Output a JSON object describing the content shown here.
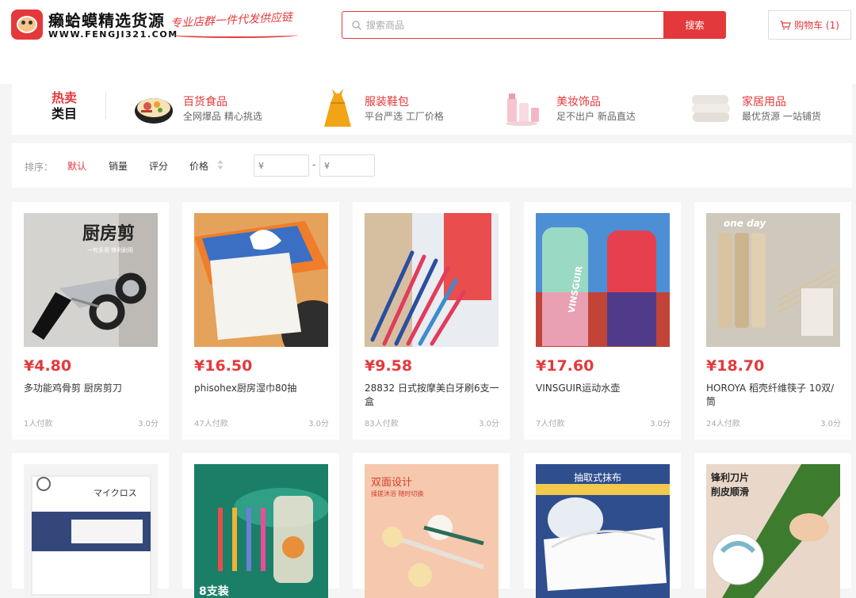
{
  "header": {
    "brand_name": "癞蛤蟆精选货源",
    "brand_domain": "WWW.FENGJI321.COM",
    "slogan": "专业店群一件代发供应链",
    "search_placeholder": "搜索商品",
    "search_button": "搜索",
    "cart_label": "购物车 (1)"
  },
  "hot_categories": {
    "label_line1": "热卖",
    "label_line2": "类目",
    "items": [
      {
        "title": "百货食品",
        "subtitle": "全网爆品 精心挑选",
        "icon": "noodle-bowl-icon"
      },
      {
        "title": "服装鞋包",
        "subtitle": "平台严选 工厂价格",
        "icon": "dress-icon"
      },
      {
        "title": "美妆饰品",
        "subtitle": "足不出户 新品直达",
        "icon": "cosmetics-icon"
      },
      {
        "title": "家居用品",
        "subtitle": "最优货源 一站铺货",
        "icon": "towel-icon"
      }
    ]
  },
  "sort": {
    "label": "排序：",
    "options": [
      "默认",
      "销量",
      "评分",
      "价格"
    ],
    "active": "默认",
    "price_min_placeholder": "¥",
    "price_max_placeholder": "¥",
    "separator": "-"
  },
  "products": [
    {
      "price": "¥4.80",
      "name": "多功能鸡骨剪 厨房剪刀",
      "sold": "1人付款",
      "score": "3.0分",
      "image_text": "厨房剪",
      "image_subtext": "一剪多用 锋利耐用"
    },
    {
      "price": "¥16.50",
      "name": "phisohex厨房湿巾80抽",
      "sold": "47人付款",
      "score": "3.0分"
    },
    {
      "price": "¥9.58",
      "name": "28832 日式按摩美白牙刷6支一盒",
      "sold": "83人付款",
      "score": "3.0分"
    },
    {
      "price": "¥17.60",
      "name": "VINSGUIR运动水壶",
      "sold": "7人付款",
      "score": "3.0分",
      "image_text": "VINSGUIR"
    },
    {
      "price": "¥18.70",
      "name": "HOROYA 稻壳纤维筷子 10双/筒",
      "sold": "24人付款",
      "score": "3.0分",
      "image_text": "one day"
    },
    {
      "image_text": "マイクロス"
    },
    {
      "image_text": "8支装"
    },
    {
      "image_text": "双面设计",
      "image_subtext": "揉搓沐浴 随时切换"
    },
    {
      "image_text": "抽取式抹布"
    },
    {
      "image_text": "锋利刀片",
      "image_subtext": "削皮顺滑"
    }
  ],
  "colors": {
    "accent": "#e4393c",
    "background": "#f5f5f5"
  }
}
